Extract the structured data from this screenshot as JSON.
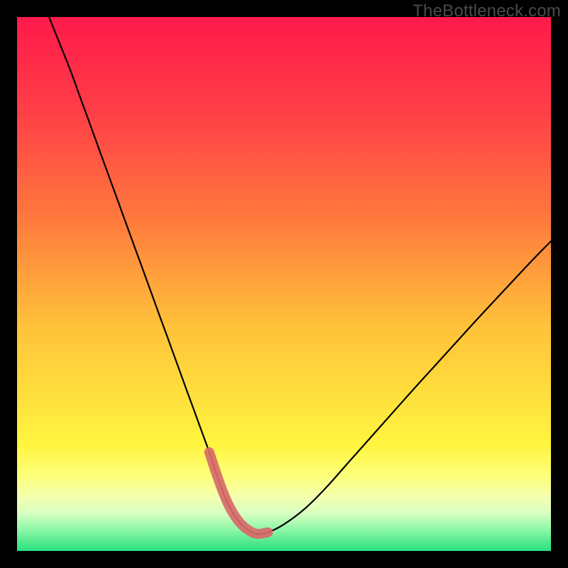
{
  "watermark": "TheBottleneck.com",
  "chart_data": {
    "type": "line",
    "title": "",
    "xlabel": "",
    "ylabel": "",
    "xlim": [
      0,
      100
    ],
    "ylim": [
      0,
      100
    ],
    "gradient_stops": [
      {
        "offset": 0,
        "color": "#ff1a4b"
      },
      {
        "offset": 18,
        "color": "#ff3f47"
      },
      {
        "offset": 38,
        "color": "#ff7a3d"
      },
      {
        "offset": 58,
        "color": "#ffc23a"
      },
      {
        "offset": 72,
        "color": "#ffe23d"
      },
      {
        "offset": 80,
        "color": "#fff53e"
      },
      {
        "offset": 86,
        "color": "#fdff7a"
      },
      {
        "offset": 90,
        "color": "#f3ffb0"
      },
      {
        "offset": 93,
        "color": "#d6ffc1"
      },
      {
        "offset": 96,
        "color": "#8cf7a7"
      },
      {
        "offset": 100,
        "color": "#28e07d"
      }
    ],
    "series": [
      {
        "name": "bottleneck-curve",
        "x": [
          6,
          8,
          10,
          12,
          14,
          16,
          18,
          20,
          22,
          24,
          26,
          28,
          30,
          32,
          34,
          36,
          37.5,
          39,
          40.5,
          42,
          43.5,
          45,
          47,
          50,
          54,
          58,
          62,
          66,
          70,
          74,
          78,
          82,
          86,
          90,
          94,
          98,
          100
        ],
        "y": [
          100,
          95,
          90,
          84.5,
          79,
          73.5,
          68,
          62.5,
          57,
          51.5,
          46,
          40.5,
          35,
          29.5,
          24,
          18.5,
          14,
          10,
          7,
          5,
          3.8,
          3.2,
          3.5,
          5,
          8,
          12,
          16.5,
          21,
          25.5,
          30,
          34.4,
          38.8,
          43.2,
          47.5,
          51.8,
          56,
          58
        ]
      },
      {
        "name": "highlight-segment",
        "x": [
          36,
          37.5,
          39,
          40.5,
          42,
          43.5,
          45,
          47
        ],
        "y": [
          18.5,
          14,
          10,
          7,
          5,
          3.8,
          3.2,
          3.5
        ]
      }
    ],
    "annotations": []
  }
}
